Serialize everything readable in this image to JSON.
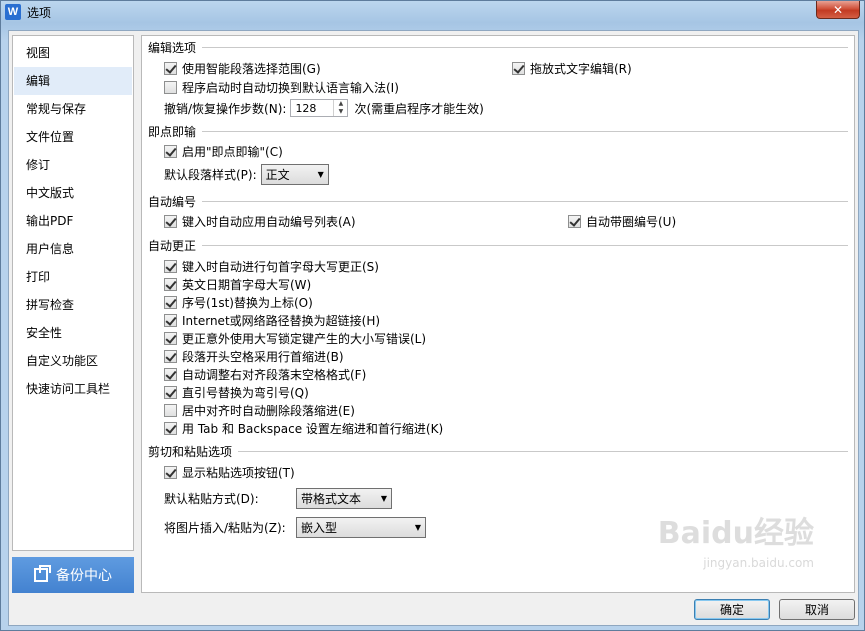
{
  "window": {
    "title": "选项",
    "app_icon": "W",
    "close_label": "✕"
  },
  "sidebar": {
    "items": [
      {
        "label": "视图"
      },
      {
        "label": "编辑",
        "active": true
      },
      {
        "label": "常规与保存"
      },
      {
        "label": "文件位置"
      },
      {
        "label": "修订"
      },
      {
        "label": "中文版式"
      },
      {
        "label": "输出PDF"
      },
      {
        "label": "用户信息"
      },
      {
        "label": "打印"
      },
      {
        "label": "拼写检查"
      },
      {
        "label": "安全性"
      },
      {
        "label": "自定义功能区"
      },
      {
        "label": "快速访问工具栏"
      }
    ],
    "backup_label": "备份中心"
  },
  "edit_options": {
    "title": "编辑选项",
    "smart_select": {
      "label": "使用智能段落选择范围(G)",
      "checked": true
    },
    "drag_drop": {
      "label": "拖放式文字编辑(R)",
      "checked": true
    },
    "auto_ime": {
      "label": "程序启动时自动切换到默认语言输入法(I)",
      "checked": false
    },
    "undo_label": "撤销/恢复操作步数(N):",
    "undo_value": "128",
    "undo_suffix": "次(需重启程序才能生效)"
  },
  "click_type": {
    "title": "即点即输",
    "enable": {
      "label": "启用\"即点即输\"(C)",
      "checked": true
    },
    "default_style_label": "默认段落样式(P):",
    "default_style_value": "正文"
  },
  "auto_number": {
    "title": "自动编号",
    "auto_list": {
      "label": "键入时自动应用自动编号列表(A)",
      "checked": true
    },
    "auto_circle": {
      "label": "自动带圈编号(U)",
      "checked": true
    }
  },
  "autocorrect": {
    "title": "自动更正",
    "items": [
      {
        "label": "键入时自动进行句首字母大写更正(S)",
        "checked": true
      },
      {
        "label": "英文日期首字母大写(W)",
        "checked": true
      },
      {
        "label": "序号(1st)替换为上标(O)",
        "checked": true
      },
      {
        "label": "Internet或网络路径替换为超链接(H)",
        "checked": true
      },
      {
        "label": "更正意外使用大写锁定键产生的大小写错误(L)",
        "checked": true
      },
      {
        "label": "段落开头空格采用行首缩进(B)",
        "checked": true
      },
      {
        "label": "自动调整右对齐段落末空格格式(F)",
        "checked": true
      },
      {
        "label": "直引号替换为弯引号(Q)",
        "checked": true
      },
      {
        "label": "居中对齐时自动删除段落缩进(E)",
        "checked": false
      },
      {
        "label": "用 Tab 和 Backspace 设置左缩进和首行缩进(K)",
        "checked": true
      }
    ]
  },
  "paste": {
    "title": "剪切和粘贴选项",
    "show_button": {
      "label": "显示粘贴选项按钮(T)",
      "checked": true
    },
    "default_paste_label": "默认粘贴方式(D):",
    "default_paste_value": "带格式文本",
    "image_insert_label": "将图片插入/粘贴为(Z):",
    "image_insert_value": "嵌入型"
  },
  "footer": {
    "ok_label": "确定",
    "cancel_label": "取消"
  },
  "watermark": {
    "text": "Baidu经验",
    "sub": "jingyan.baidu.com"
  },
  "colors": {
    "accent": "#4382d0",
    "active_nav": "#e1ecf9"
  }
}
